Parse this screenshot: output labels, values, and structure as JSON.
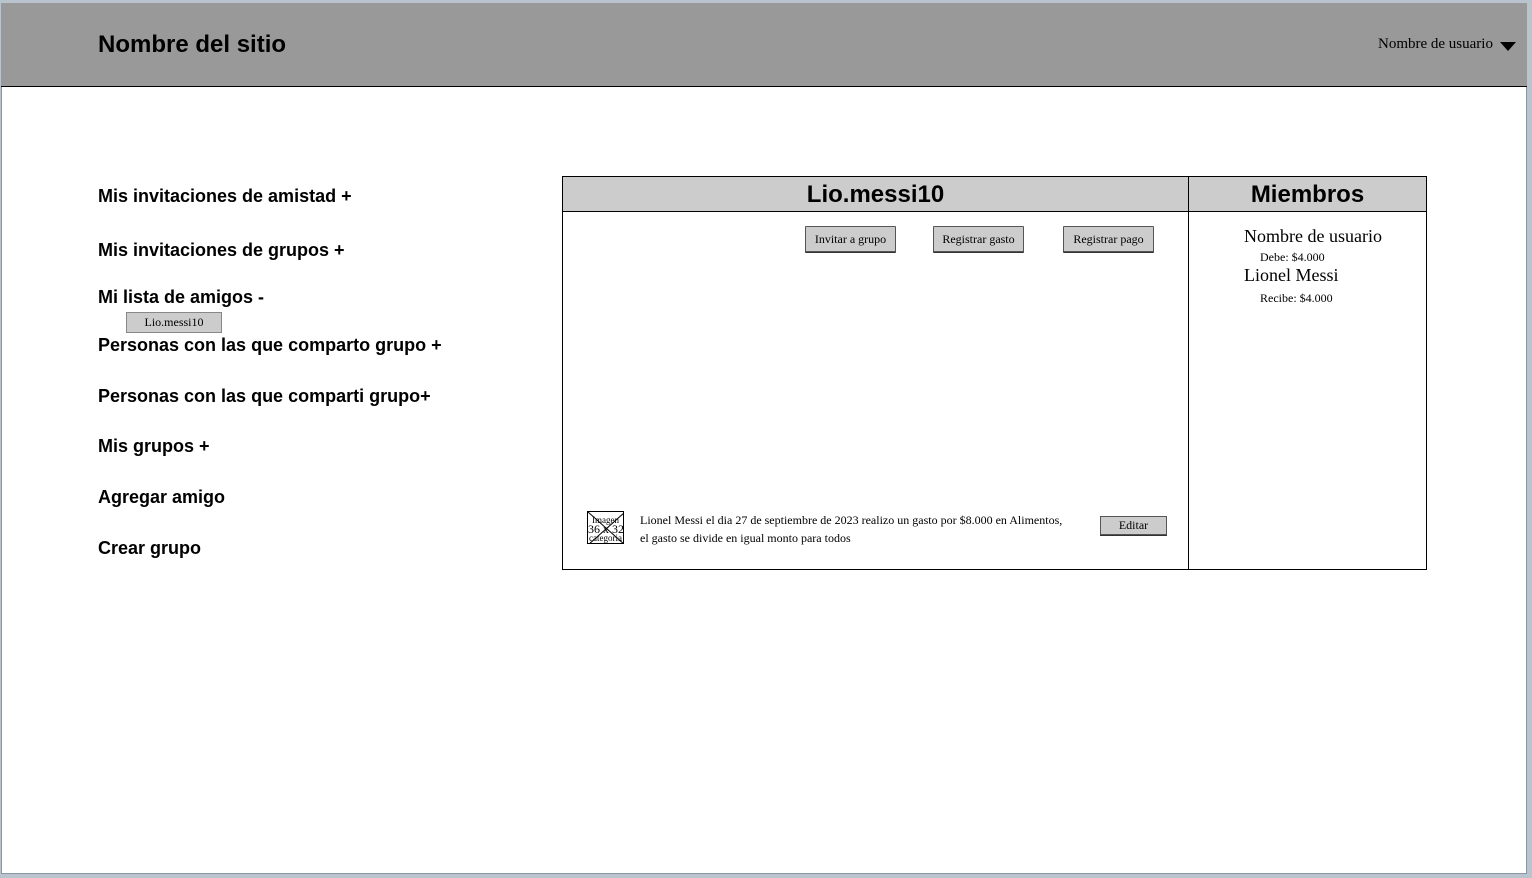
{
  "header": {
    "site_title": "Nombre del sitio",
    "user_menu_label": "Nombre de usuario",
    "user_menu_icon": "chevron-down-icon"
  },
  "sidebar": {
    "friend_invitations": "Mis invitaciones de amistad +",
    "group_invitations": "Mis invitaciones de grupos +",
    "friend_list": "Mi lista de amigos -",
    "friends": [
      "Lio.messi10"
    ],
    "sharing_group_with": "Personas con las que comparto grupo +",
    "shared_group_with": "Personas con las que comparti grupo+",
    "my_groups": "Mis grupos +",
    "add_friend": "Agregar amigo",
    "create_group": "Crear grupo"
  },
  "main": {
    "title": "Lio.messi10",
    "actions": {
      "invite": "Invitar a grupo",
      "register_expense": "Registrar gasto",
      "register_payment": "Registrar pago"
    },
    "expense": {
      "image_label_top": "Imagen",
      "image_size": "36 x 32",
      "image_label_bottom": "categoria",
      "line1": "Lionel Messi el dia 27 de septiembre de 2023 realizo un gasto por $8.000 en Alimentos,",
      "line2": "el gasto se divide en igual monto para todos",
      "edit_label": "Editar"
    }
  },
  "members": {
    "title": "Miembros",
    "list": [
      {
        "name": "Nombre de usuario",
        "balance": "Debe: $4.000"
      },
      {
        "name": "Lionel Messi",
        "balance": "Recibe: $4.000"
      }
    ]
  }
}
